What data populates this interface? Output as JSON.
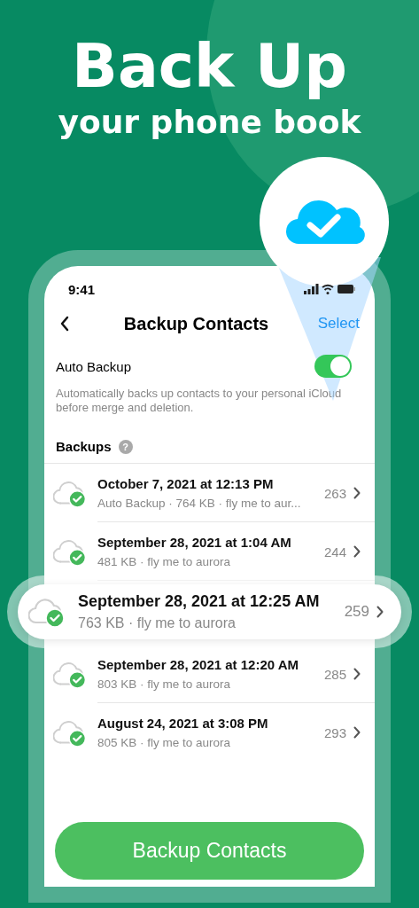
{
  "headline": "Back Up",
  "subheadline": "your phone book",
  "status_bar": {
    "time": "9:41"
  },
  "nav": {
    "title": "Backup Contacts",
    "action": "Select"
  },
  "auto_backup": {
    "label": "Auto Backup",
    "on": true,
    "description": "Automatically backs up contacts to your personal iCloud before merge and deletion."
  },
  "backups": {
    "title": "Backups",
    "help": "?",
    "rows": [
      {
        "date": "October 7, 2021 at 12:13 PM",
        "details": "Auto Backup · 764 KB · fly me to aur...",
        "count": "263",
        "highlighted": false
      },
      {
        "date": "September 28, 2021 at 1:04 AM",
        "details": "481 KB · fly me to aurora",
        "count": "244",
        "highlighted": false
      },
      {
        "date": "September 28, 2021 at 12:25 AM",
        "details": "763 KB · fly me to aurora",
        "count": "259",
        "highlighted": true
      },
      {
        "date": "September 28, 2021 at 12:20 AM",
        "details": "803 KB · fly me to aurora",
        "count": "285",
        "highlighted": false
      },
      {
        "date": "August 24, 2021 at 3:08 PM",
        "details": "805 KB · fly me to aurora",
        "count": "293",
        "highlighted": false
      }
    ]
  },
  "primary_button": "Backup Contacts"
}
